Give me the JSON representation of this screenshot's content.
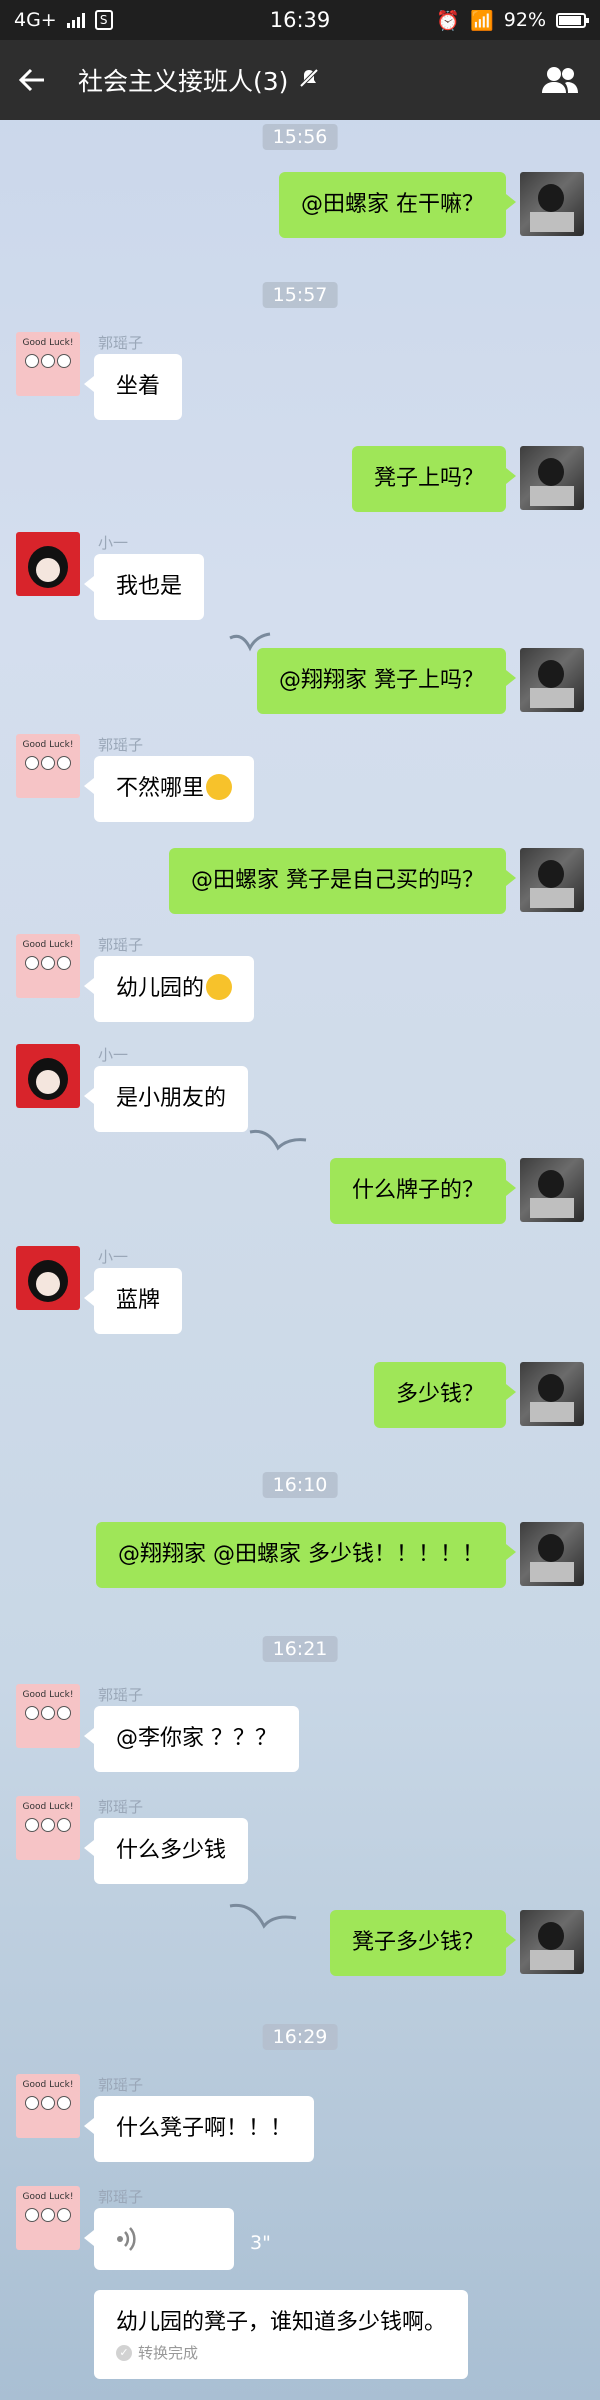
{
  "status_bar": {
    "network": "4G+",
    "time": "16:39",
    "battery": "92%"
  },
  "header": {
    "title": "社会主义接班人(3)",
    "back_icon": "arrow-left-icon",
    "mute_icon": "bell-muted-icon",
    "members_icon": "group-members-icon"
  },
  "timestamps": [
    "15:56",
    "15:57",
    "16:10",
    "16:21",
    "16:29"
  ],
  "messages": [
    {
      "text": "@田螺家  在干嘛？"
    },
    {
      "sender": "郭瑶子",
      "text": "坐着"
    },
    {
      "text": "凳子上吗？"
    },
    {
      "sender": "小一",
      "text": "我也是"
    },
    {
      "text": "@翔翔家  凳子上吗？"
    },
    {
      "sender": "郭瑶子",
      "text": "不然哪里"
    },
    {
      "text": "@田螺家  凳子是自己买的吗？"
    },
    {
      "sender": "郭瑶子",
      "text": "幼儿园的"
    },
    {
      "sender": "小一",
      "text": "是小朋友的"
    },
    {
      "text": "什么牌子的？"
    },
    {
      "sender": "小一",
      "text": "蓝牌"
    },
    {
      "text": "多少钱？"
    },
    {
      "text": "@翔翔家 @田螺家  多少钱！！！！！"
    },
    {
      "sender": "郭瑶子",
      "text": "@李你家 ？？？"
    },
    {
      "sender": "郭瑶子",
      "text": "什么多少钱"
    },
    {
      "text": "凳子多少钱？"
    },
    {
      "sender": "郭瑶子",
      "text": "什么凳子啊！！！"
    }
  ],
  "voice": {
    "sender": "郭瑶子",
    "duration": "3\"",
    "transcript": "幼儿园的凳子，谁知道多少钱啊。",
    "status": "转换完成"
  },
  "avatar_labels": {
    "goodluck": "Good Luck!"
  }
}
